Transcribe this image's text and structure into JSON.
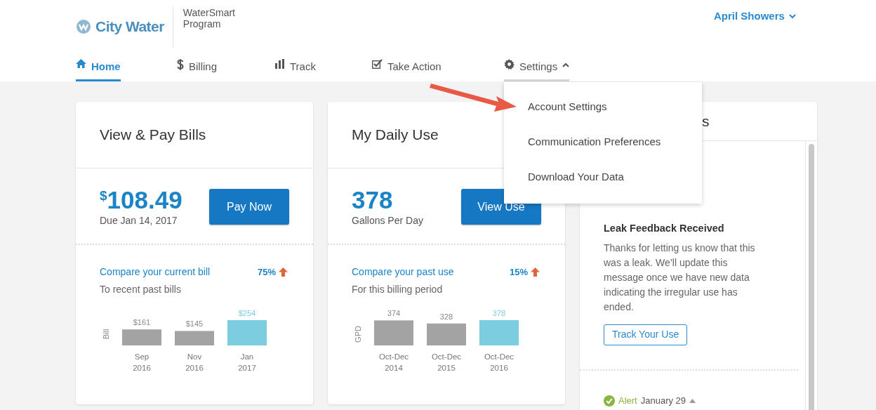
{
  "header": {
    "brand": "City Water",
    "program": "WaterSmart Program",
    "user": "April Showers"
  },
  "tabs": [
    {
      "label": "Home",
      "selected": true,
      "expanded": false
    },
    {
      "label": "Billing",
      "selected": false,
      "expanded": false
    },
    {
      "label": "Track",
      "selected": false,
      "expanded": false
    },
    {
      "label": "Take Action",
      "selected": false,
      "expanded": false
    },
    {
      "label": "Settings",
      "selected": false,
      "expanded": true
    }
  ],
  "settings_menu": [
    "Account Settings",
    "Communication Preferences",
    "Download Your Data"
  ],
  "cards": [
    {
      "kind": "summary",
      "title": "View & Pay Bills",
      "currency": "$",
      "figure": "108.49",
      "caption": "Due Jan 14, 2017",
      "button": "Pay Now",
      "compare": "Compare your current bill",
      "change": "75%",
      "subtitle": "To recent past bills",
      "chart_data": {
        "type": "bar",
        "ylabel": "Bill",
        "categories": [
          "Sep 2016",
          "Nov 2016",
          "Jan 2017"
        ],
        "values": [
          161,
          145,
          254
        ],
        "value_labels": [
          "$161",
          "$145",
          "$254"
        ]
      }
    },
    {
      "kind": "summary",
      "title": "My Daily Use",
      "figure": "378",
      "caption": "Gallons Per Day",
      "button": "View Use",
      "compare": "Compare your past use",
      "change": "15%",
      "subtitle": "For this billing period",
      "chart_data": {
        "type": "bar",
        "ylabel": "GPD",
        "categories": [
          "Oct-Dec 2014",
          "Oct-Dec 2015",
          "Oct-Dec 2016"
        ],
        "values": [
          374,
          328,
          378
        ],
        "value_labels": [
          "374",
          "328",
          "378"
        ]
      }
    },
    {
      "kind": "alerts",
      "title": "s",
      "alert": {
        "heading": "Leak Feedback Received",
        "text": "Thanks for letting us know that this was a leak. We’ll update this message once we have new data indicating the irregular use has ended.",
        "button": "Track Your Use"
      },
      "next_alert": {
        "type": "Alert",
        "date": "January 29"
      }
    }
  ]
}
